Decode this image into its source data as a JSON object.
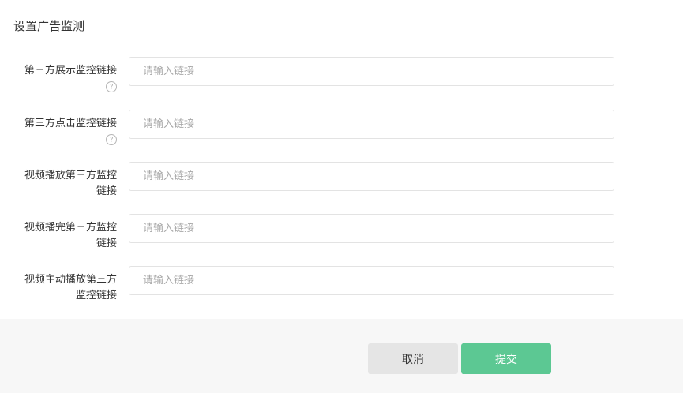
{
  "dialog": {
    "title": "设置广告监测"
  },
  "form": {
    "placeholder": "请输入链接",
    "fields": [
      {
        "label": "第三方展示监控链接",
        "help": "?"
      },
      {
        "label": "第三方点击监控链接",
        "help": "?"
      },
      {
        "label_line1": "视频播放第三方监控",
        "label_line2": "链接"
      },
      {
        "label_line1": "视频播完第三方监控",
        "label_line2": "链接"
      },
      {
        "label_line1": "视频主动播放第三方",
        "label_line2": "监控链接"
      }
    ]
  },
  "footer": {
    "cancel_label": "取消",
    "submit_label": "提交"
  },
  "colors": {
    "submit": "#5cc893",
    "cancel": "#e5e5e5",
    "footer_bg": "#f7f7f7"
  }
}
